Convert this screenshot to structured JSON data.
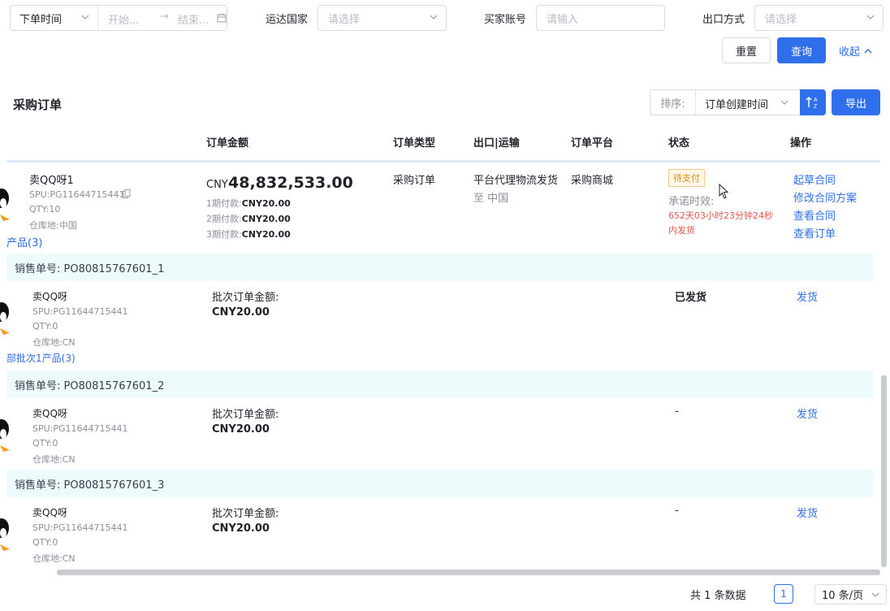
{
  "filters": {
    "date_type": "下单时间",
    "start_placeholder": "开始...",
    "arrow": "→",
    "end_placeholder": "结束...",
    "country_label": "运达国家",
    "country_placeholder": "请选择",
    "buyer_label": "买家账号",
    "buyer_placeholder": "请输入",
    "export_label": "出口方式",
    "export_placeholder": "请选择"
  },
  "actions": {
    "reset": "重置",
    "query": "查询",
    "collapse": "收起"
  },
  "section": {
    "title": "采购订单",
    "sort_label": "排序:",
    "sort_value": "订单创建时间",
    "export_btn": "导出"
  },
  "table": {
    "headers": [
      "订单金额",
      "订单类型",
      "出口|运输",
      "订单平台",
      "状态",
      "操作"
    ],
    "order": {
      "product_name": "卖QQ呀1",
      "spu": "SPU:PG11644715441",
      "qty": "QTY:10",
      "warehouse": "仓库地:中国",
      "products_link": "产品(3)",
      "amount_prefix": "CNY",
      "amount": "48,832,533.00",
      "installments": [
        {
          "label": "1期付款:",
          "value": "CNY20.00"
        },
        {
          "label": "2期付款:",
          "value": "CNY20.00"
        },
        {
          "label": "3期付款:",
          "value": "CNY20.00"
        }
      ],
      "type": "采购订单",
      "shipping": "平台代理物流发货",
      "destination": "至 中国",
      "platform": "采购商城",
      "status": "待支付",
      "promise_label": "承诺时效:",
      "promise_time": "652天03小时23分钟24秒",
      "promise_suffix": "内发货",
      "operations": [
        "起草合同",
        "修改合同方案",
        "查看合同",
        "查看订单"
      ]
    },
    "sub_orders": [
      {
        "sales_no": "销售单号:  PO80815767601_1",
        "product_name": "卖QQ呀",
        "spu": "SPU:PG11644715441",
        "qty": "QTY:0",
        "warehouse": "仓库地:CN",
        "batch_link": "部批次1产品(3)",
        "batch_label": "批次订单金额:",
        "batch_amount": "CNY20.00",
        "status": "已发货",
        "action": "发货"
      },
      {
        "sales_no": "销售单号:  PO80815767601_2",
        "product_name": "卖QQ呀",
        "spu": "SPU:PG11644715441",
        "qty": "QTY:0",
        "warehouse": "仓库地:CN",
        "batch_label": "批次订单金额:",
        "batch_amount": "CNY20.00",
        "status": "-",
        "action": "发货"
      },
      {
        "sales_no": "销售单号:  PO80815767601_3",
        "product_name": "卖QQ呀",
        "spu": "SPU:PG11644715441",
        "qty": "QTY:0",
        "warehouse": "仓库地:CN",
        "batch_label": "批次订单金额:",
        "batch_amount": "CNY20.00",
        "status": "-",
        "action": "发货"
      }
    ]
  },
  "pagination": {
    "total": "共 1 条数据",
    "page": "1",
    "page_size": "10 条/页"
  },
  "colors": {
    "primary": "#2f6fec",
    "row_highlight": "#eefbfd",
    "warning": "#e08a1a",
    "danger": "#e8584b"
  }
}
